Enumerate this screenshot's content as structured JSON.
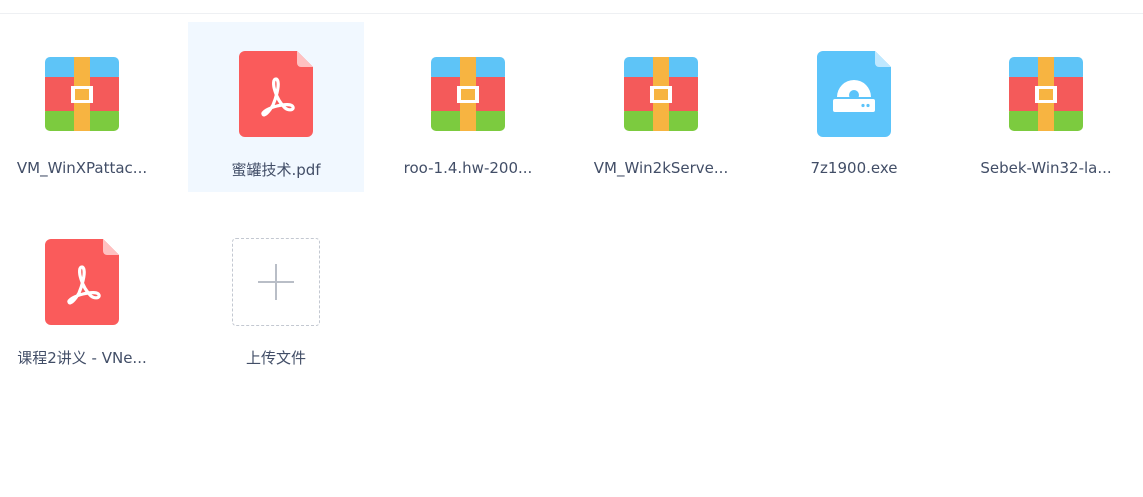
{
  "files": [
    {
      "name": "VM_WinXPattac...",
      "type": "archive",
      "icon": "archive-icon"
    },
    {
      "name": "蜜罐技术.pdf",
      "type": "pdf",
      "icon": "pdf-icon",
      "selected": true
    },
    {
      "name": "roo-1.4.hw-200...",
      "type": "archive",
      "icon": "archive-icon"
    },
    {
      "name": "VM_Win2kServe...",
      "type": "archive",
      "icon": "archive-icon"
    },
    {
      "name": "7z1900.exe",
      "type": "executable",
      "icon": "exe-disc-icon"
    },
    {
      "name": "Sebek-Win32-la...",
      "type": "archive",
      "icon": "archive-icon"
    },
    {
      "name": "课程2讲义 - VNe...",
      "type": "pdf",
      "icon": "pdf-icon"
    }
  ],
  "upload": {
    "label": "上传文件",
    "icon": "plus-icon"
  },
  "colors": {
    "archive_top": "#5ec4f7",
    "archive_middle": "#f45a5a",
    "archive_bottom": "#7ccb3f",
    "archive_strap": "#f7b441",
    "pdf_red": "#fa5b5b",
    "exe_blue": "#5cc4fa",
    "selected_bg": "#f1f8ff",
    "label_text": "#424e67"
  }
}
